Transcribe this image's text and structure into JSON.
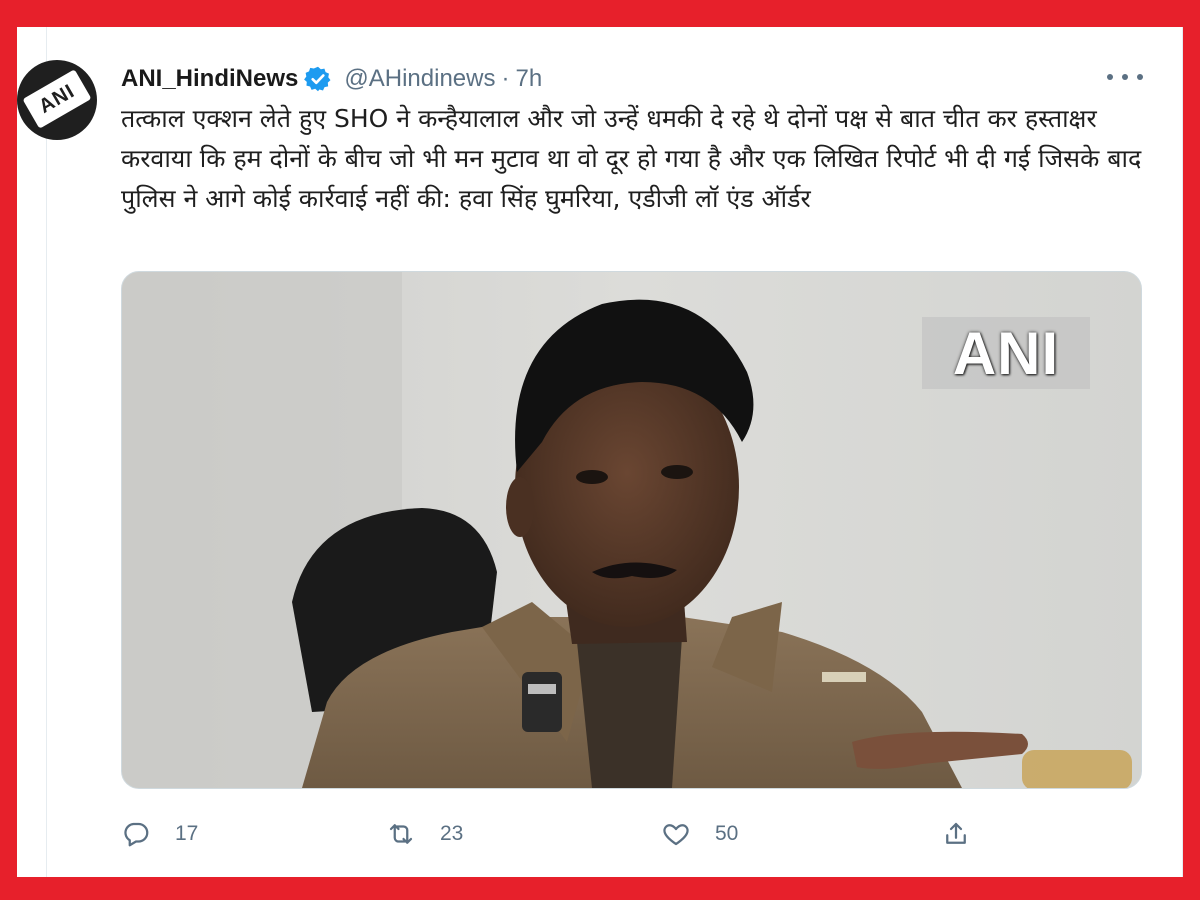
{
  "tweet": {
    "display_name": "ANI_HindiNews",
    "handle": "@AHindinews",
    "separator": "·",
    "time": "7h",
    "avatar_logo": "ANI",
    "verified_icon": "verified-badge-icon",
    "text": "तत्काल एक्शन लेते हुए SHO ने कन्हैयालाल और जो उन्हें धमकी दे रहे थे दोनों पक्ष से बात चीत कर हस्ताक्षर करवाया कि हम दोनों के बीच जो भी मन मुटाव था वो दूर हो गया है और एक लिखित रिपोर्ट भी दी गई जिसके बाद पुलिस ने आगे कोई कार्रवाई नहीं की: हवा सिंह घुमरिया, एडीजी लॉ एंड ऑर्डर",
    "media_watermark": "ANI"
  },
  "actions": {
    "reply": {
      "icon": "reply-icon",
      "count": "17"
    },
    "retweet": {
      "icon": "retweet-icon",
      "count": "23"
    },
    "like": {
      "icon": "heart-icon",
      "count": "50"
    },
    "share": {
      "icon": "share-icon"
    }
  },
  "colors": {
    "frame": "#e7202b",
    "verified": "#1d9bf0",
    "muted": "#5b7083",
    "text": "#1f1f1f"
  }
}
